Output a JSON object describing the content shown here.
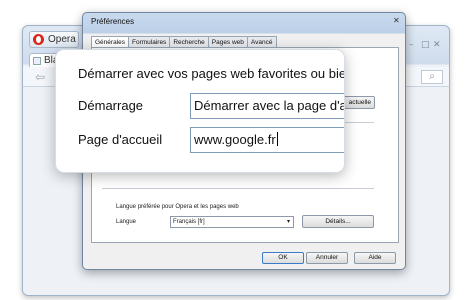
{
  "browser": {
    "opera_button": "Opera",
    "tab_label": "Blan",
    "search_icon": "search-icon"
  },
  "dialog": {
    "title": "Préférences",
    "tabs": [
      "Générales",
      "Formulaires",
      "Recherche",
      "Pages web",
      "Avancé"
    ],
    "active_tab": "Générales",
    "partial_button": "actuelle",
    "language_header": "Langue préférée pour Opera et les pages web",
    "language_label": "Langue",
    "language_value": "Français [fr]",
    "details_button": "Détails...",
    "ok_button": "OK",
    "cancel_button": "Annuler",
    "help_button": "Aide"
  },
  "zoom": {
    "heading": "Démarrer avec vos pages web favorites ou bien co",
    "startup_label": "Démarrage",
    "startup_value": "Démarrer avec la page d'ac",
    "homepage_label": "Page d'accueil",
    "homepage_value": "www.google.fr"
  },
  "colors": {
    "dialog_frame": "#bcd0e8",
    "field_border": "#7f9db9",
    "opera_red": "#d9261c"
  }
}
